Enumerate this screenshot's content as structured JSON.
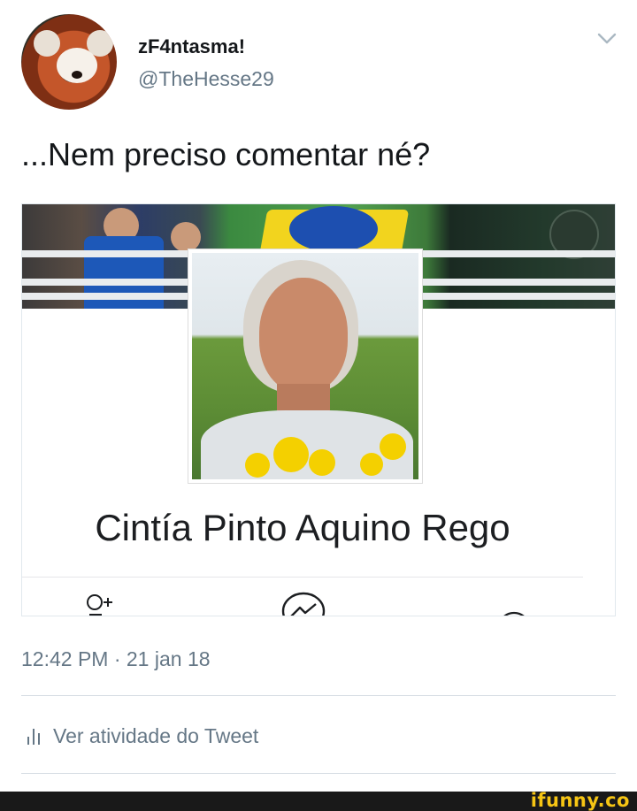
{
  "tweet": {
    "author": {
      "display_name": "zF4ntasma!",
      "handle": "@TheHesse29",
      "avatar_icon": "red-panda-avatar"
    },
    "menu_icon": "chevron-down-icon",
    "text": "...Nem preciso comentar né?",
    "timestamp": "12:42 PM · 21 jan 18",
    "activity": {
      "icon": "bar-chart-icon",
      "label": "Ver atividade do Tweet"
    }
  },
  "media": {
    "profile_name": "Cintía Pinto Aquino Rego",
    "actions": [
      {
        "icon": "add-friend-icon"
      },
      {
        "icon": "messenger-icon"
      },
      {
        "icon": "more-icon"
      }
    ]
  },
  "watermark": "ifunny.co",
  "colors": {
    "text_primary": "#14171a",
    "text_secondary": "#657786",
    "divider": "#d6dde3",
    "watermark": "#f6c514"
  }
}
